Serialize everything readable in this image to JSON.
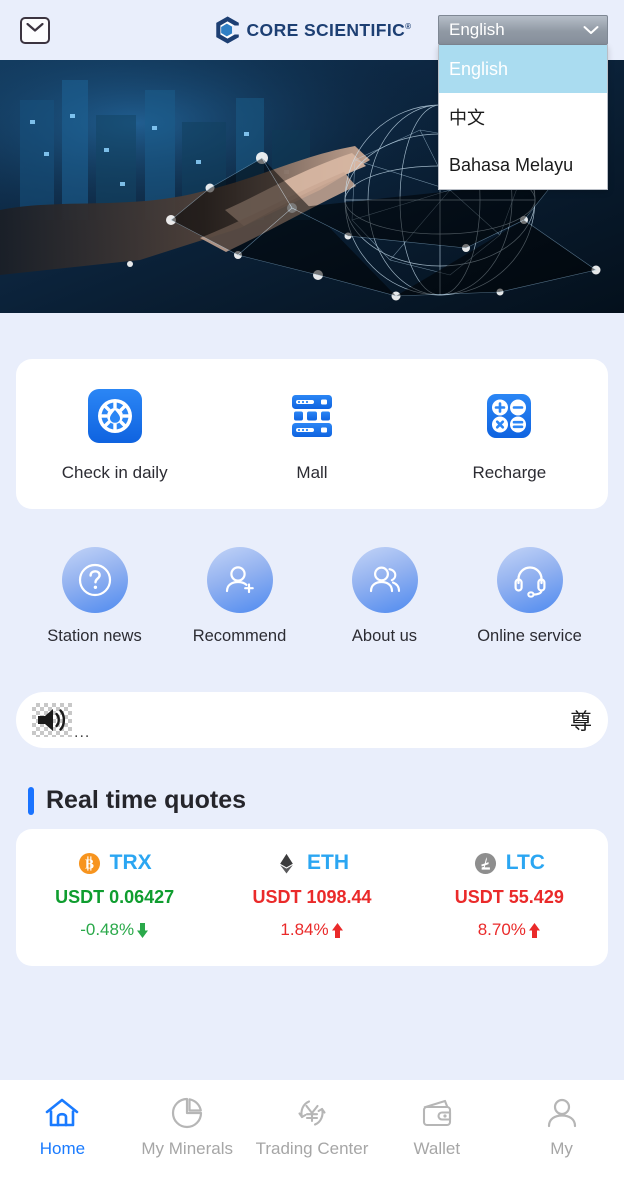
{
  "header": {
    "mail_icon": "envelope-icon",
    "brand": "CORE SCIENTIFIC",
    "brand_registered": "®",
    "language": {
      "selected": "English",
      "options": [
        "English",
        "中文",
        "Bahasa Melayu"
      ],
      "expanded": true,
      "highlight_color": "#aadcf0"
    }
  },
  "hero": {
    "alt": "hand touching digital globe network banner"
  },
  "quick_actions": [
    {
      "label": "Check in daily",
      "icon": "prize-wheel-icon"
    },
    {
      "label": "Mall",
      "icon": "server-stack-icon"
    },
    {
      "label": "Recharge",
      "icon": "calculator-icon"
    }
  ],
  "shortcuts": [
    {
      "label": "Station news",
      "icon": "question-mark-icon"
    },
    {
      "label": "Recommend",
      "icon": "user-plus-icon"
    },
    {
      "label": "About us",
      "icon": "users-icon"
    },
    {
      "label": "Online service",
      "icon": "headset-icon"
    }
  ],
  "notice": {
    "icon": "speaker-icon",
    "text": "...",
    "tail_text": "尊"
  },
  "quotes_section": {
    "title": "Real time quotes",
    "accent_color": "#1a73ff",
    "items": [
      {
        "symbol": "TRX",
        "coin_icon": "bitcoin-coin-icon",
        "coin_color": "#f7941e",
        "coin_glyph": "฿",
        "price": "USDT 0.06427",
        "price_color": "#0f9d2f",
        "change": "-0.48%",
        "direction": "down",
        "change_color": "#2aa94a"
      },
      {
        "symbol": "ETH",
        "coin_icon": "ethereum-coin-icon",
        "coin_color": "#3c3c3d",
        "coin_glyph": "♦",
        "price": "USDT 1098.44",
        "price_color": "#ea2a2a",
        "change": "1.84%",
        "direction": "up",
        "change_color": "#ea2a2a"
      },
      {
        "symbol": "LTC",
        "coin_icon": "litecoin-coin-icon",
        "coin_color": "#8e8e8e",
        "coin_glyph": "Ł",
        "price": "USDT 55.429",
        "price_color": "#ea2a2a",
        "change": "8.70%",
        "direction": "up",
        "change_color": "#ea2a2a"
      }
    ]
  },
  "tabbar": {
    "active_color": "#1a7bff",
    "items": [
      {
        "label": "Home",
        "icon": "home-icon",
        "active": true
      },
      {
        "label": "My Minerals",
        "icon": "pie-chart-icon",
        "active": false
      },
      {
        "label": "Trading Center",
        "icon": "yen-exchange-icon",
        "active": false
      },
      {
        "label": "Wallet",
        "icon": "wallet-icon",
        "active": false
      },
      {
        "label": "My",
        "icon": "person-icon",
        "active": false
      }
    ]
  }
}
